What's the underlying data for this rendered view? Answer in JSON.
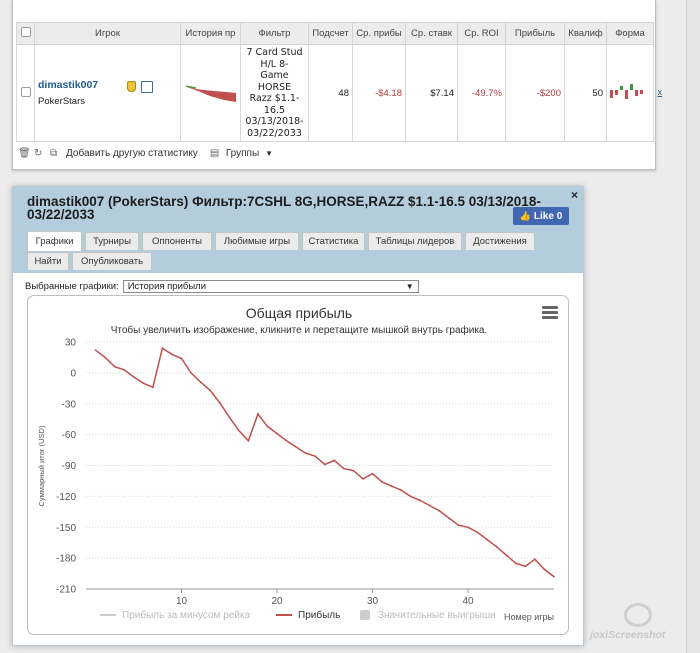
{
  "stats_table": {
    "headers": [
      "Игрок",
      "История пр",
      "Фильтр",
      "Подсчет",
      "Ср. прибы",
      "Ср. ставк",
      "Ср. ROI",
      "Прибыль",
      "Квалиф",
      "Форма"
    ],
    "row": {
      "player_name": "dimastik007",
      "site": "PokerStars",
      "filter_lines": [
        "7 Card Stud",
        "H/L 8-",
        "Game",
        "HORSE",
        "Razz $1.1-",
        "16.5",
        "03/13/2018-",
        "03/22/2033"
      ],
      "count": "48",
      "avg_profit": "-$4.18",
      "avg_stake": "$7.14",
      "avg_roi": "-49.7%",
      "profit": "-$200",
      "qualified": "50",
      "extra": "x"
    }
  },
  "toolbar": {
    "add_stat_label": "Добавить другую статистику",
    "groups_label": "Группы"
  },
  "widget": {
    "title": "dimastik007 (PokerStars) Фильтр:7CSHL 8G,HORSE,RAZZ $1.1-16.5 03/13/2018-03/22/2033",
    "like_label": "Like 0",
    "close_label": "×",
    "tabs": [
      {
        "label": "Графики",
        "active": true
      },
      {
        "label": "Турниры"
      },
      {
        "label": "Оппоненты"
      },
      {
        "label": "Любимые игры"
      },
      {
        "label": "Статистика"
      },
      {
        "label": "Таблицы лидеров"
      },
      {
        "label": "Достижения"
      },
      {
        "label": "Найти"
      },
      {
        "label": "Опубликовать"
      }
    ],
    "select_label": "Выбранные графики:",
    "select_value": "История прибыли"
  },
  "chart_data": {
    "type": "line",
    "title": "Общая прибыль",
    "subtitle": "Чтобы увеличить изображение, кликните и перетащите мышкой внутрь графика.",
    "ylabel": "Суммарный итог (USD)",
    "xlabel": "Номер игры",
    "ylim": [
      -210,
      30
    ],
    "yticks": [
      30,
      0,
      -30,
      -60,
      -90,
      -120,
      -150,
      -180,
      -210
    ],
    "xlim": [
      0,
      49
    ],
    "xticks": [
      10,
      20,
      30,
      40
    ],
    "grid": true,
    "legend_position": "bottom",
    "legend": [
      {
        "label": "Прибыль за минусом рейка",
        "color": "#cccccc"
      },
      {
        "label": "Прибыль",
        "color": "#c0504d"
      },
      {
        "label": "Значительные выигрыши",
        "color": "#cccccc"
      }
    ],
    "series": [
      {
        "name": "Прибыль",
        "color": "#c0504d",
        "x": [
          1,
          2,
          3,
          4,
          5,
          6,
          7,
          8,
          9,
          10,
          11,
          12,
          13,
          14,
          15,
          16,
          17,
          18,
          19,
          20,
          21,
          22,
          23,
          24,
          25,
          26,
          27,
          28,
          29,
          30,
          31,
          32,
          33,
          34,
          35,
          36,
          37,
          38,
          39,
          40,
          41,
          42,
          43,
          44,
          45,
          46,
          47,
          48,
          49
        ],
        "y": [
          22,
          15,
          6,
          3,
          -4,
          -10,
          -14,
          24,
          18,
          14,
          0,
          -9,
          -17,
          -29,
          -43,
          -56,
          -66,
          -40,
          -52,
          -59,
          -66,
          -72,
          -78,
          -81,
          -89,
          -85,
          -93,
          -95,
          -103,
          -98,
          -106,
          -110,
          -114,
          -120,
          -124,
          -129,
          -134,
          -141,
          -148,
          -150,
          -155,
          -162,
          -169,
          -177,
          -185,
          -188,
          -181,
          -191,
          -198
        ]
      }
    ]
  },
  "watermark": "joxiScreenshot"
}
